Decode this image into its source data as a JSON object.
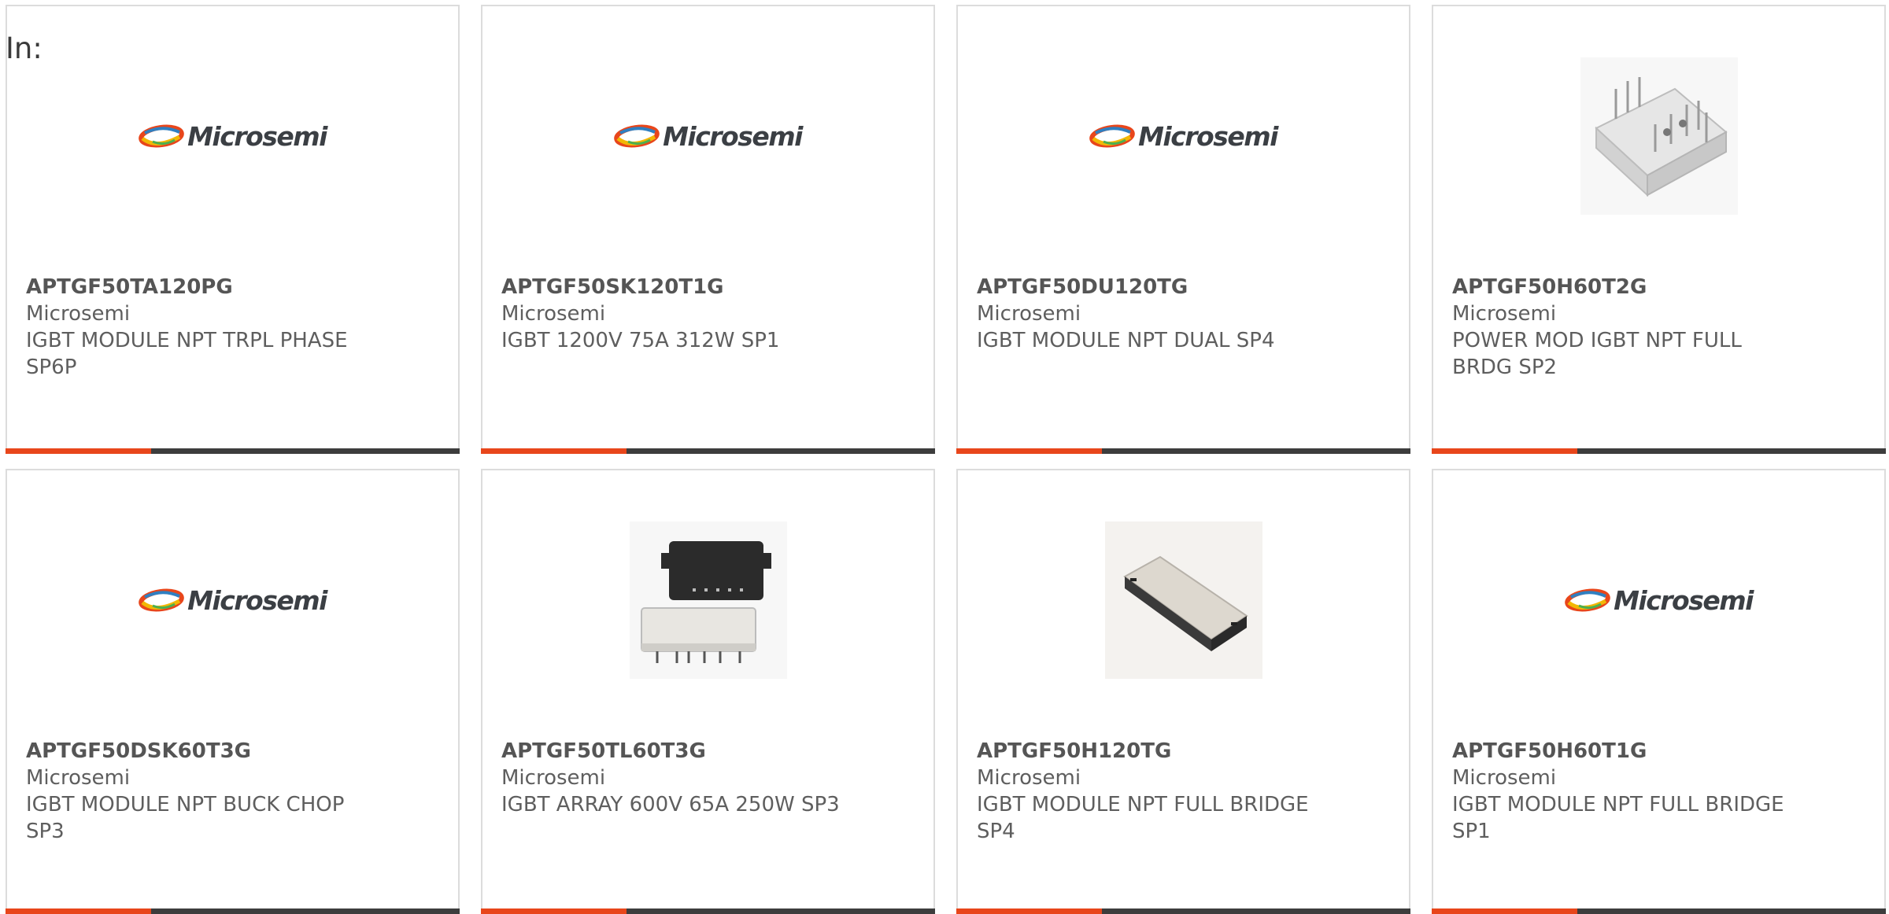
{
  "filter": {
    "label": "In:"
  },
  "brand": {
    "logo_text": "Microsemi"
  },
  "colors": {
    "accent": "#e8461b",
    "bar": "#3d3d3d",
    "border": "#dcdcdc"
  },
  "products": [
    {
      "part": "APTGF50TA120PG",
      "maker": "Microsemi",
      "desc1": "IGBT MODULE NPT TRPL PHASE",
      "desc2": "SP6P",
      "image": "microsemi-logo"
    },
    {
      "part": "APTGF50SK120T1G",
      "maker": "Microsemi",
      "desc1": "IGBT 1200V 75A 312W SP1",
      "desc2": "",
      "image": "microsemi-logo"
    },
    {
      "part": "APTGF50DU120TG",
      "maker": "Microsemi",
      "desc1": "IGBT MODULE NPT DUAL SP4",
      "desc2": "",
      "image": "microsemi-logo"
    },
    {
      "part": "APTGF50H60T2G",
      "maker": "Microsemi",
      "desc1": "POWER MOD IGBT NPT FULL",
      "desc2": "BRDG SP2",
      "image": "module-photo-white-pins"
    },
    {
      "part": "APTGF50DSK60T3G",
      "maker": "Microsemi",
      "desc1": "IGBT MODULE NPT BUCK CHOP",
      "desc2": "SP3",
      "image": "microsemi-logo"
    },
    {
      "part": "APTGF50TL60T3G",
      "maker": "Microsemi",
      "desc1": "IGBT ARRAY 600V 65A 250W SP3",
      "desc2": "",
      "image": "module-photo-black-white"
    },
    {
      "part": "APTGF50H120TG",
      "maker": "Microsemi",
      "desc1": "IGBT MODULE NPT FULL BRIDGE",
      "desc2": "SP4",
      "image": "module-photo-flat"
    },
    {
      "part": "APTGF50H60T1G",
      "maker": "Microsemi",
      "desc1": "IGBT MODULE NPT FULL BRIDGE",
      "desc2": "SP1",
      "image": "microsemi-logo"
    }
  ]
}
